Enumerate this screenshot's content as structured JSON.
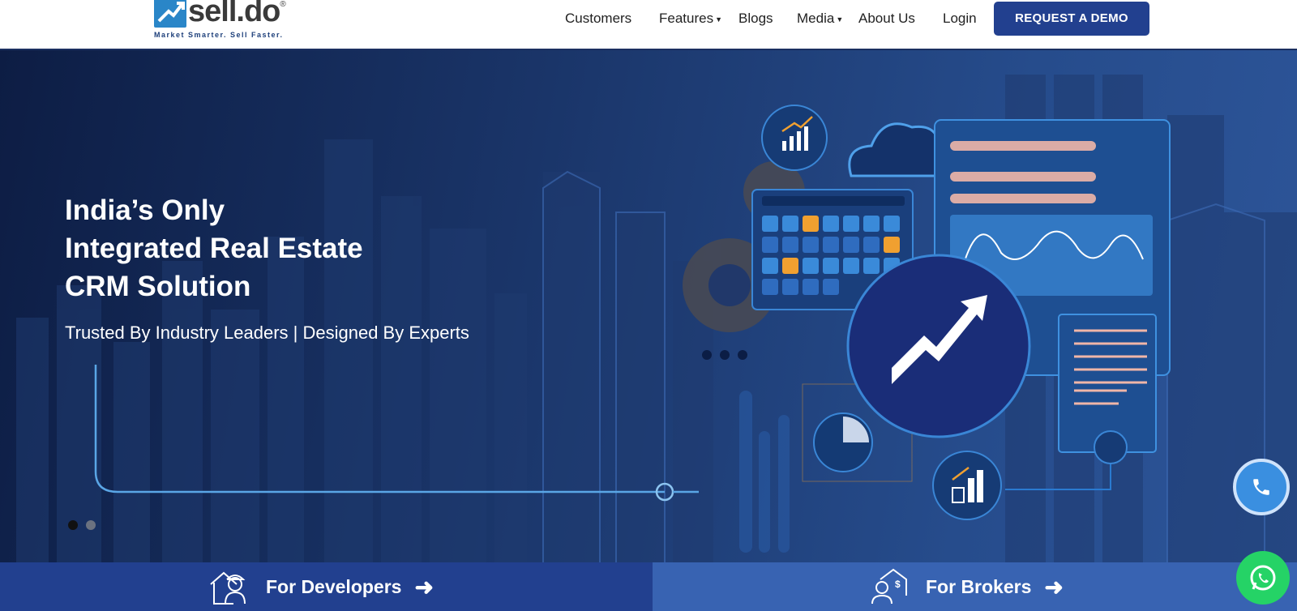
{
  "brand": {
    "name": "sell.do",
    "registered": "®",
    "tagline": "Market Smarter. Sell Faster.",
    "accent": "#22408f"
  },
  "nav": {
    "items": [
      {
        "label": "Customers",
        "dropdown": false
      },
      {
        "label": "Features",
        "dropdown": true
      },
      {
        "label": "Blogs",
        "dropdown": false
      },
      {
        "label": "Media",
        "dropdown": true
      },
      {
        "label": "About Us",
        "dropdown": false
      },
      {
        "label": "Login",
        "dropdown": false
      }
    ],
    "cta": "REQUEST A DEMO"
  },
  "hero": {
    "title_lines": [
      "India’s Only",
      "Integrated Real Estate",
      "CRM Solution"
    ],
    "subtitle": "Trusted By Industry Leaders | Designed By Experts",
    "slides": {
      "count": 2,
      "active": 1
    }
  },
  "bottom": {
    "developers": "For Developers",
    "brokers": "For Brokers",
    "developer_icon": "builder-icon",
    "broker_icon": "broker-icon",
    "arrow_icon": "arrow-right-icon"
  },
  "floating": {
    "call_icon": "phone-icon",
    "whatsapp_icon": "whatsapp-icon"
  }
}
